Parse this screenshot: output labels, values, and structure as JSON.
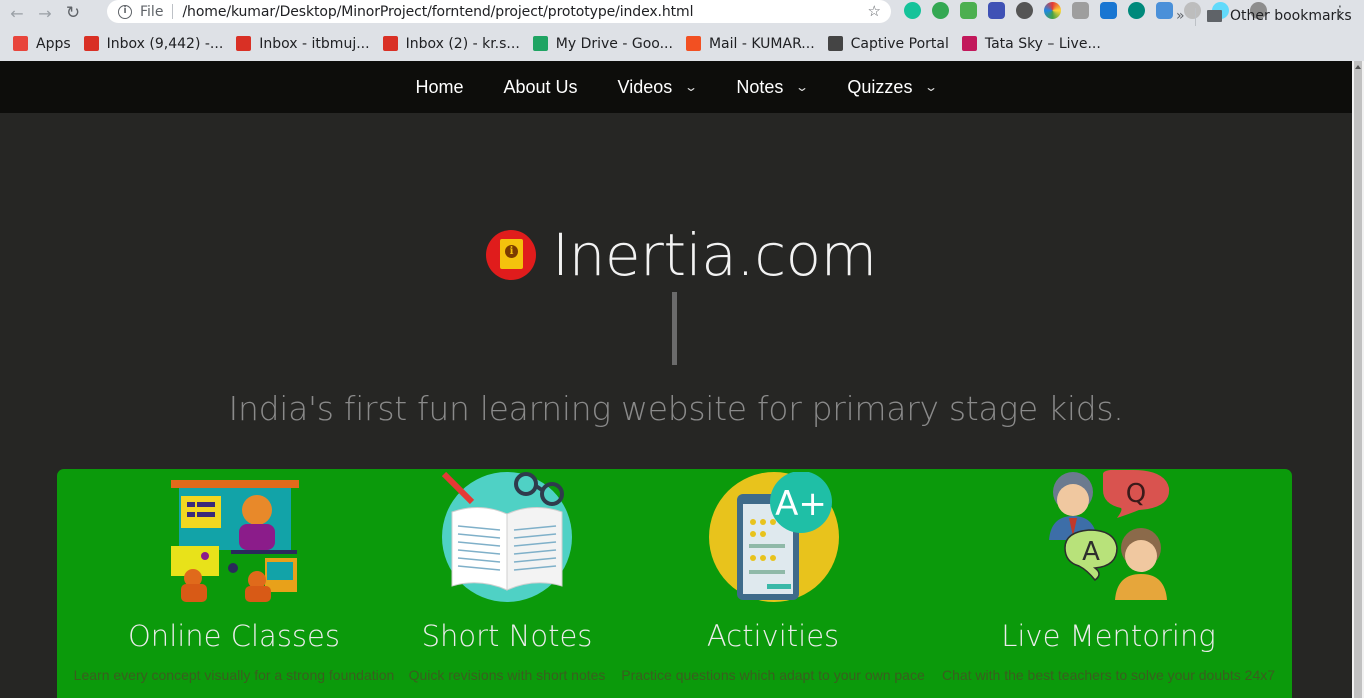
{
  "browser": {
    "url_scheme_label": "File",
    "url": "/home/kumar/Desktop/MinorProject/forntend/project/prototype/index.html",
    "bookmarks": [
      {
        "label": "Apps",
        "icon": "apps-grid-icon",
        "color": "#e8453c"
      },
      {
        "label": "Inbox (9,442) -...",
        "icon": "gmail-icon",
        "color": "#d93025"
      },
      {
        "label": "Inbox - itbmuj...",
        "icon": "gmail-icon",
        "color": "#d93025"
      },
      {
        "label": "Inbox (2) - kr.s...",
        "icon": "gmail-icon",
        "color": "#d93025"
      },
      {
        "label": "My Drive - Goo...",
        "icon": "drive-icon",
        "color": "#1fa463"
      },
      {
        "label": "Mail - KUMAR...",
        "icon": "microsoft-icon",
        "color": "#f25022"
      },
      {
        "label": "Captive Portal",
        "icon": "portal-icon",
        "color": "#444444"
      },
      {
        "label": "Tata Sky – Live...",
        "icon": "tatasky-icon",
        "color": "#c2185b"
      }
    ],
    "more_label": "»",
    "other_bookmarks": "Other bookmarks"
  },
  "nav": {
    "items": [
      {
        "label": "Home",
        "dropdown": false
      },
      {
        "label": "About Us",
        "dropdown": false
      },
      {
        "label": "Videos",
        "dropdown": true
      },
      {
        "label": "Notes",
        "dropdown": true
      },
      {
        "label": "Quizzes",
        "dropdown": true
      }
    ]
  },
  "hero": {
    "title": "Inertia.com",
    "tagline": "India's first fun learning website for primary stage kids."
  },
  "features": [
    {
      "title": "Online Classes",
      "desc": "Learn every concept visually for a strong foundation",
      "icon": "online-classes-icon"
    },
    {
      "title": "Short Notes",
      "desc": "Quick revisions with short notes",
      "icon": "short-notes-icon"
    },
    {
      "title": "Activities",
      "desc": "Practice questions which adapt to your own pace",
      "icon": "activities-icon"
    },
    {
      "title": "Live Mentoring",
      "desc": "Chat with the best teachers to solve your doubts 24x7",
      "icon": "live-mentoring-icon"
    }
  ],
  "colors": {
    "page_bg": "#262624",
    "nav_bg": "#0d0d0b",
    "feature_bg": "#0b9a0b",
    "logo_red": "#e01c1c",
    "logo_yellow": "#f4c20d"
  }
}
